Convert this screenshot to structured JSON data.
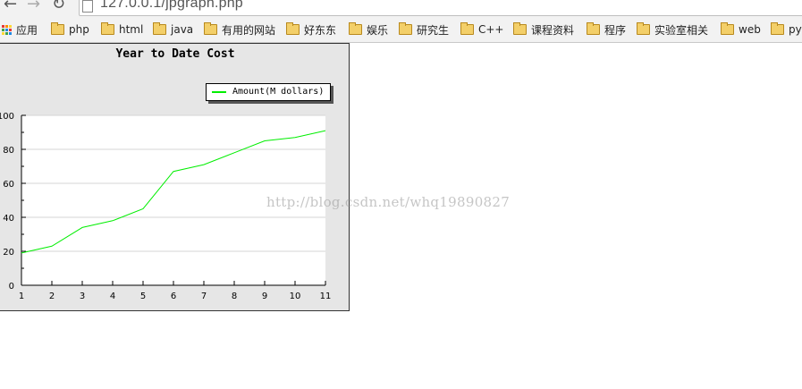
{
  "browser": {
    "url": "127.0.0.1/jpgraph.php",
    "bookmarks": [
      {
        "label": "应用",
        "icon": "apps-icon"
      },
      {
        "label": "php",
        "icon": "folder-icon"
      },
      {
        "label": "html",
        "icon": "folder-icon"
      },
      {
        "label": "java",
        "icon": "folder-icon"
      },
      {
        "label": "有用的网站",
        "icon": "folder-icon"
      },
      {
        "label": "好东东",
        "icon": "folder-icon"
      },
      {
        "label": "娱乐",
        "icon": "folder-icon"
      },
      {
        "label": "研究生",
        "icon": "folder-icon"
      },
      {
        "label": "C++",
        "icon": "folder-icon"
      },
      {
        "label": "课程资料",
        "icon": "folder-icon"
      },
      {
        "label": "程序",
        "icon": "folder-icon"
      },
      {
        "label": "实验室相关",
        "icon": "folder-icon"
      },
      {
        "label": "web",
        "icon": "folder-icon"
      },
      {
        "label": "py",
        "icon": "folder-icon"
      }
    ]
  },
  "chart_data": {
    "type": "line",
    "title": "Year to Date Cost",
    "x": [
      1,
      2,
      3,
      4,
      5,
      6,
      7,
      8,
      9,
      10,
      11
    ],
    "series": [
      {
        "name": "Amount(M dollars)",
        "color": "#00ee00",
        "values": [
          19,
          23,
          34,
          38,
          45,
          67,
          71,
          78,
          85,
          87,
          91
        ]
      }
    ],
    "xlabel": "",
    "ylabel": "",
    "ylim": [
      0,
      100
    ],
    "yticks": [
      0,
      20,
      40,
      60,
      80,
      100
    ],
    "xticks": [
      1,
      2,
      3,
      4,
      5,
      6,
      7,
      8,
      9,
      10,
      11
    ],
    "grid": true,
    "legend_position": "top-right"
  },
  "watermark": "http://blog.csdn.net/whq19890827"
}
